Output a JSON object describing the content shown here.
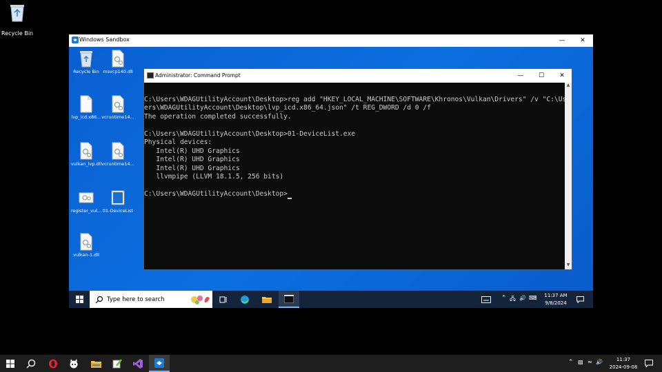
{
  "host": {
    "recycle_bin_label": "Recycle Bin",
    "taskbar": {
      "clock_time": "11:37",
      "clock_date": "2024-09-08"
    }
  },
  "sandbox": {
    "title": "Windows Sandbox",
    "desktop_icons": [
      {
        "label": "Recycle Bin",
        "icon": "recycle-bin-icon"
      },
      {
        "label": "msvcp140.dll",
        "icon": "dll-file-icon"
      },
      {
        "label": "lvp_icd.x86...",
        "icon": "json-file-icon"
      },
      {
        "label": "vcruntime14...",
        "icon": "dll-file-icon"
      },
      {
        "label": "vulkan_lvp.dll",
        "icon": "dll-file-icon"
      },
      {
        "label": "vcruntime14...",
        "icon": "dll-file-icon"
      },
      {
        "label": "register_vul...",
        "icon": "dll-file-icon"
      },
      {
        "label": "01-DeviceList",
        "icon": "exe-file-icon"
      },
      {
        "label": "vulkan-1.dll",
        "icon": "dll-file-icon"
      }
    ],
    "taskbar": {
      "search_placeholder": "Type here to search",
      "clock_time": "11:37 AM",
      "clock_date": "9/8/2024"
    }
  },
  "cmd": {
    "title": "Administrator: Command Prompt",
    "lines": [
      "",
      "C:\\Users\\WDAGUtilityAccount\\Desktop>reg add \"HKEY_LOCAL_MACHINE\\SOFTWARE\\Khronos\\Vulkan\\Drivers\" /v \"C:\\Us",
      "ers\\WDAGUtilityAccount\\Desktop\\lvp_icd.x86_64.json\" /t REG_DWORD /d 0 /f",
      "The operation completed successfully.",
      "",
      "C:\\Users\\WDAGUtilityAccount\\Desktop>01-DeviceList.exe",
      "Physical devices:",
      "   Intel(R) UHD Graphics",
      "   Intel(R) UHD Graphics",
      "   Intel(R) UHD Graphics",
      "   llvmpipe (LLVM 18.1.5, 256 bits)",
      "",
      "C:\\Users\\WDAGUtilityAccount\\Desktop>"
    ]
  },
  "colors": {
    "sandbox_desktop": "#0c6fe0",
    "sandbox_taskbar": "#14243a",
    "host_taskbar": "#1e1e1e",
    "console_bg": "#0c0c0c",
    "console_text": "#cccccc"
  }
}
